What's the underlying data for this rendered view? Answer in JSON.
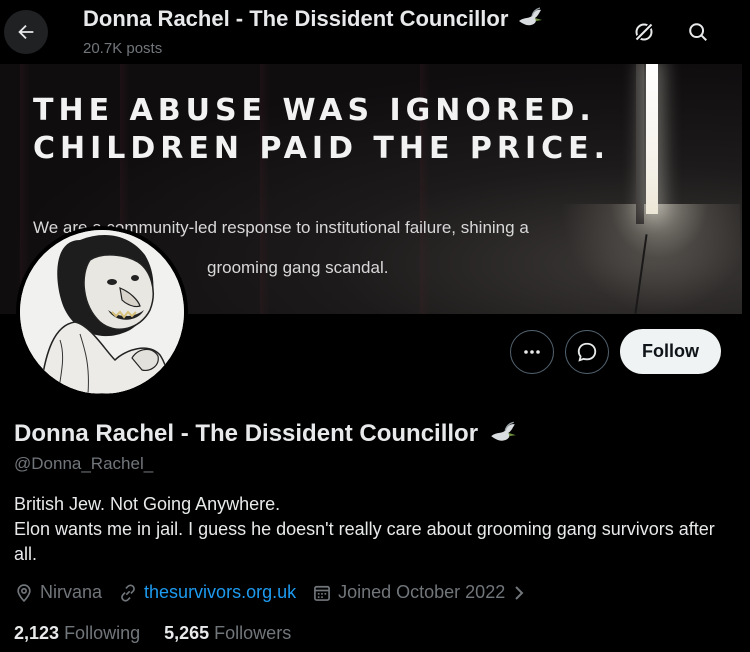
{
  "header": {
    "title": "Donna Rachel - The Dissident Councillor",
    "posts_count": "20.7K posts",
    "title_emoji_icon": "dove-icon"
  },
  "banner": {
    "headline_line1": "THE ABUSE WAS IGNORED.",
    "headline_line2": "CHILDREN PAID THE PRICE.",
    "body_line1": "We are a community-led response to institutional failure, shining a",
    "body_line2": "grooming gang scandal."
  },
  "profile": {
    "display_name": "Donna Rachel - The Dissident Councillor",
    "handle": "@Donna_Rachel_",
    "bio_line1": "British Jew. Not Going Anywhere.",
    "bio_line2": "Elon wants me in jail. I guess he doesn't really care about grooming gang survivors after all.",
    "location": "Nirvana",
    "website": "thesurvivors.org.uk",
    "joined": "Joined October 2022",
    "following_count": "2,123",
    "following_label": "Following",
    "followers_count": "5,265",
    "followers_label": "Followers"
  },
  "actions": {
    "follow_label": "Follow"
  },
  "colors": {
    "background": "#000000",
    "text_primary": "#e7e9ea",
    "text_secondary": "#71767b",
    "link": "#1d9bf0",
    "follow_bg": "#eff3f4"
  }
}
